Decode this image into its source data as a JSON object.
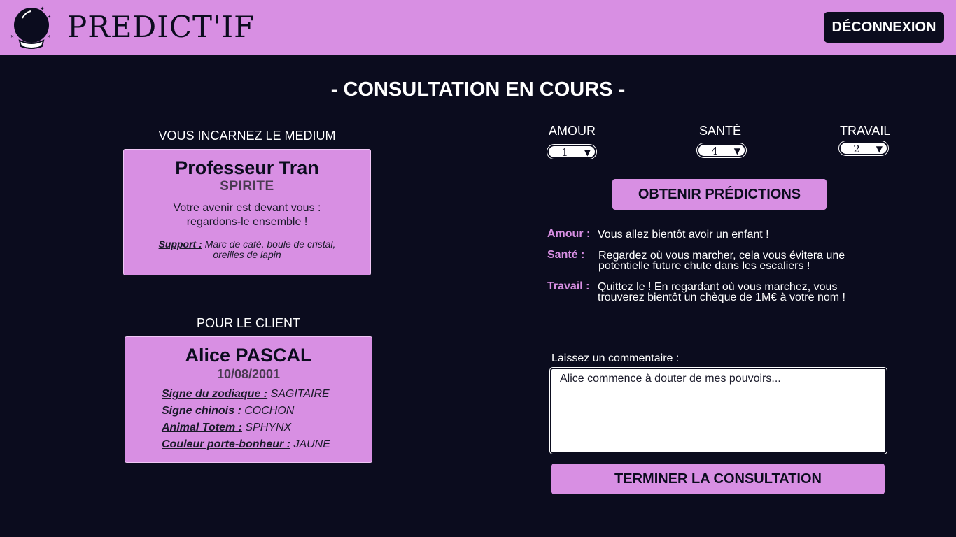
{
  "header": {
    "brand": "PREDICT'IF",
    "logo_icon": "crystal-ball-icon",
    "logout_label": "DÉCONNEXION"
  },
  "page_title": "- CONSULTATION EN COURS -",
  "medium": {
    "section_label": "VOUS INCARNEZ LE MEDIUM",
    "name": "Professeur Tran",
    "type": "SPIRITE",
    "quote_line1": "Votre avenir est devant vous :",
    "quote_line2": "regardons-le ensemble !",
    "support_label": "Support :",
    "support_text": "Marc de café, boule de cristal,",
    "support_text2": "oreilles de lapin"
  },
  "client": {
    "section_label": "POUR LE CLIENT",
    "name": "Alice PASCAL",
    "birthdate": "10/08/2001",
    "zodiac_label": "Signe du zodiaque :",
    "zodiac_value": "SAGITAIRE",
    "chinese_label": "Signe chinois :",
    "chinese_value": "COCHON",
    "totem_label": "Animal Totem :",
    "totem_value": "SPHYNX",
    "color_label": "Couleur porte-bonheur :",
    "color_value": "JAUNE"
  },
  "ratings": {
    "amour_label": "AMOUR",
    "amour_value": "1",
    "sante_label": "SANTÉ",
    "sante_value": "4",
    "travail_label": "TRAVAIL",
    "travail_value": "2",
    "dropdown_icon": "triangle-down-icon"
  },
  "predictions": {
    "button_label": "OBTENIR PRÉDICTIONS",
    "amour_label": "Amour :",
    "amour_text": "Vous allez bientôt avoir un enfant !",
    "sante_label": "Santé :",
    "sante_line1": "Regardez où vous marcher, cela vous évitera une",
    "sante_line2": "potentielle future chute dans les escaliers !",
    "travail_label": "Travail :",
    "travail_line1": "Quittez le ! En regardant où vous marchez, vous",
    "travail_line2": "trouverez bientôt un chèque de 1M€ à votre nom !"
  },
  "comment": {
    "label": "Laissez un commentaire :",
    "value": "Alice commence à douter de mes pouvoirs..."
  },
  "end_button_label": "TERMINER LA CONSULTATION",
  "colors": {
    "background": "#0b0c1e",
    "accent": "#d88fe3",
    "text_light": "#ffffff"
  }
}
